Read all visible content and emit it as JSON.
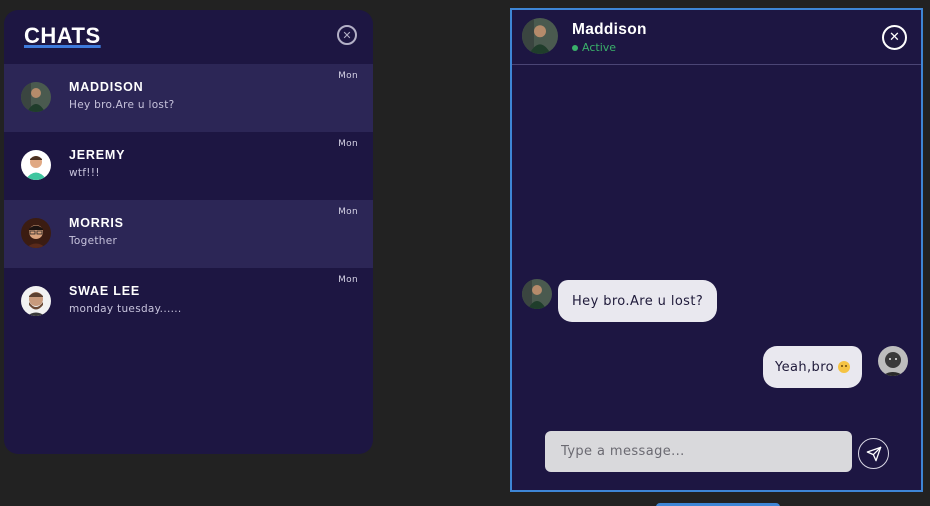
{
  "chats_panel": {
    "title": "CHATS",
    "items": [
      {
        "name": "MADDISON",
        "preview": "Hey bro.Are u lost?",
        "time": "Mon",
        "highlighted": true
      },
      {
        "name": "JEREMY",
        "preview": "wtf!!!",
        "time": "Mon",
        "highlighted": false
      },
      {
        "name": "MORRIS",
        "preview": "Together",
        "time": "Mon",
        "highlighted": true
      },
      {
        "name": "SWAE LEE",
        "preview": "monday tuesday......",
        "time": "Mon",
        "highlighted": false
      }
    ]
  },
  "conversation": {
    "contact_name": "Maddison",
    "status": "Active",
    "messages": [
      {
        "direction": "in",
        "text": "Hey bro.Are u lost?"
      },
      {
        "direction": "out",
        "text": "Yeah,bro",
        "emoji": "slightly-smiling-emoji"
      }
    ],
    "composer_placeholder": "Type a message..."
  },
  "colors": {
    "page_bg": "#222222",
    "panel_bg": "#1d1642",
    "row_highlight": "#2c2656",
    "accent_border": "#3e86d6",
    "status_green": "#3ab06a",
    "bubble_bg": "#e9e8ef"
  },
  "icons": {
    "close": "close-circle-icon",
    "send": "send-paper-plane-icon",
    "status": "online-dot-icon"
  }
}
